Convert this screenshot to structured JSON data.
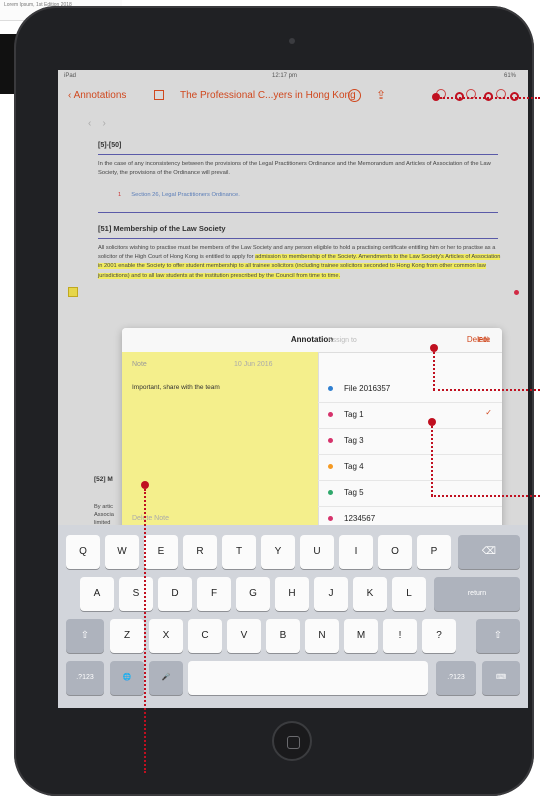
{
  "crop": {
    "text": "Lorem Ipsum, 1st Edition 2018"
  },
  "status": {
    "carrier": "iPad",
    "time": "12:17 pm",
    "battery": "61%"
  },
  "nav": {
    "back_label": "Annotations",
    "title": "The Professional C...yers in Hong Kong",
    "info": "i",
    "share": "⇪"
  },
  "doc": {
    "section_range": "[5]-[50]",
    "para1": "In the case of any inconsistency between the provisions of the Legal Practitioners Ordinance and the Memorandum and Articles of Association of the Law Society, the provisions of the Ordinance will prevail.",
    "footnote_num": "1",
    "footnote": "Section 26, Legal Practitioners Ordinance.",
    "heading": "[51] Membership of the Law Society",
    "para2_plain": "All solicitors wishing to practise must be members of the Law Society and any person eligible to hold a practising certificate entitling him or her to practise as a solicitor of the High Court of Hong Kong is entitled to apply for ",
    "para2_hl": "admission to membership of the Society. Amendments to the Law Society's Articles of Association in 2001 enable the Society to offer student membership to all trainee solicitors (including trainee solicitors seconded to Hong Kong from other common law jurisdictions) and to all law students at the institution prescribed by the Council from time to time.",
    "section52": "[52] M",
    "by_text": "By artic Associa limited"
  },
  "annotation": {
    "title": "Annotation",
    "delete": "Delete",
    "note_label": "Note",
    "note_date": "10 Jun 2016",
    "note_text": "Important, share with the team",
    "delete_note": "Delete Note",
    "assign_label": "Assign to",
    "edit": "Edit",
    "tags": [
      {
        "label": "File 2016357",
        "color": "#2f7fd0",
        "checked": false
      },
      {
        "label": "Tag 1",
        "color": "#d6336c",
        "checked": true
      },
      {
        "label": "Tag 3",
        "color": "#d6336c",
        "checked": false
      },
      {
        "label": "Tag 4",
        "color": "#f59a23",
        "checked": false
      },
      {
        "label": "Tag 5",
        "color": "#2fa86b",
        "checked": false
      },
      {
        "label": "1234567",
        "color": "#d6336c",
        "checked": false
      }
    ],
    "check": "✓"
  },
  "keyboard": {
    "row1": [
      "Q",
      "W",
      "E",
      "R",
      "T",
      "Y",
      "U",
      "I",
      "O",
      "P"
    ],
    "row2": [
      "A",
      "S",
      "D",
      "F",
      "G",
      "H",
      "J",
      "K",
      "L"
    ],
    "row3": [
      "Z",
      "X",
      "C",
      "V",
      "B",
      "N",
      "M",
      "!",
      "?"
    ],
    "delete": "⌫",
    "return": "return",
    "shift": "⇧",
    "num": ".?123",
    "globe": "🌐",
    "mic": "🎤",
    "kbd": "⌨"
  }
}
